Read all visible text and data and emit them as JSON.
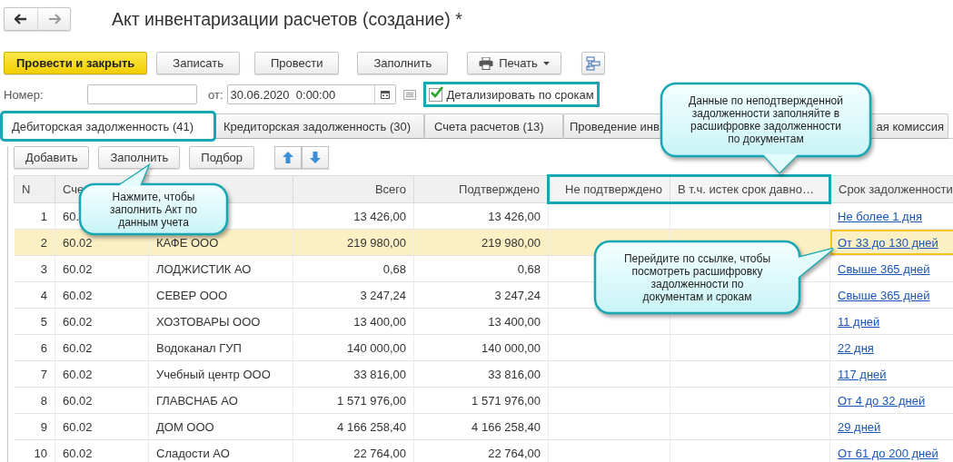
{
  "window": {
    "title": "Акт инвентаризации расчетов (создание) *"
  },
  "toolbar": [
    {
      "kind": "primary",
      "label": "Провести и закрыть"
    },
    {
      "kind": "plain",
      "label": "Записать"
    },
    {
      "kind": "plain",
      "label": "Провести"
    },
    {
      "kind": "plain",
      "label": "Заполнить"
    },
    {
      "kind": "print",
      "label": "Печать"
    },
    {
      "kind": "icon"
    }
  ],
  "header": {
    "number_label": "Номер:",
    "date_label": "от:",
    "date_value": "30.06.2020  0:00:00",
    "detail_checkbox": {
      "label": "Детализировать по срокам",
      "checked": true,
      "highlighted": true
    }
  },
  "tabs": [
    {
      "label": "Дебиторская задолженность (41)",
      "selected": true,
      "highlighted": true
    },
    {
      "label": "Кредиторская задолженность (30)",
      "selected": false,
      "highlighted": false
    },
    {
      "label": "Счета расчетов (13)",
      "selected": false,
      "highlighted": false
    },
    {
      "label": "Проведение инв",
      "selected": false,
      "highlighted": false
    },
    {
      "label": "ая комиссия",
      "selected": false,
      "highlighted": false
    }
  ],
  "table_toolbar": [
    {
      "kind": "text",
      "label": "Добавить"
    },
    {
      "kind": "text",
      "label": "Заполнить"
    },
    {
      "kind": "text",
      "label": "Подбор"
    },
    {
      "kind": "up"
    },
    {
      "kind": "down"
    }
  ],
  "table": {
    "columns": [
      {
        "label": "N",
        "highlighted": false
      },
      {
        "label": "Сче",
        "highlighted": false
      },
      {
        "highlighted": false
      },
      {
        "label": "Всего",
        "highlighted": false
      },
      {
        "label": "Подтверждено",
        "highlighted": false
      },
      {
        "label": "Не подтверждено",
        "highlighted": true
      },
      {
        "label": "В т.ч. истек срок давно…",
        "highlighted": true
      },
      {
        "label": "Срок задолженности",
        "highlighted": false
      }
    ],
    "rows": [
      {
        "n": "1",
        "account": "60.",
        "total": "13 426,00",
        "confirmed": "13 426,00",
        "term": "Не более 1 дня",
        "selected": false
      },
      {
        "n": "2",
        "account": "60.02",
        "debtor": "КАФЕ ООО",
        "total": "219 980,00",
        "confirmed": "219 980,00",
        "term": "От 33 до 130 дней",
        "selected": true
      },
      {
        "n": "3",
        "account": "60.02",
        "debtor": "ЛОДЖИСТИК АО",
        "total": "0,68",
        "confirmed": "0,68",
        "term": "Свыше 365 дней",
        "selected": false
      },
      {
        "n": "4",
        "account": "60.02",
        "debtor": "СЕВЕР ООО",
        "total": "3 247,24",
        "confirmed": "3 247,24",
        "term": "Свыше 365 дней",
        "selected": false
      },
      {
        "n": "5",
        "account": "60.02",
        "debtor": "ХОЗТОВАРЫ ООО",
        "total": "13 400,00",
        "confirmed": "13 400,00",
        "term": "11 дней",
        "selected": false
      },
      {
        "n": "6",
        "account": "60.02",
        "debtor": "Водоканал ГУП",
        "total": "140 000,00",
        "confirmed": "140 000,00",
        "term": "22 дня",
        "selected": false
      },
      {
        "n": "7",
        "account": "60.02",
        "debtor": "Учебный центр ООО",
        "total": "33 816,00",
        "confirmed": "33 816,00",
        "term": "117 дней",
        "selected": false
      },
      {
        "n": "8",
        "account": "60.02",
        "debtor": "ГЛАВСНАБ АО",
        "total": "1 571 976,00",
        "confirmed": "1 571 976,00",
        "term": "От 4 до 32 дней",
        "selected": false
      },
      {
        "n": "9",
        "account": "60.02",
        "debtor": "ДОМ ООО",
        "total": "4 166 258,40",
        "confirmed": "4 166 258,40",
        "term": "29 дней",
        "selected": false
      },
      {
        "n": "10",
        "account": "60.02",
        "debtor": "Сладости АО",
        "total": "22 764,00",
        "confirmed": "22 764,00",
        "term": "От 61 до 200 дней",
        "selected": false
      }
    ]
  },
  "callouts": [
    {
      "text": "Нажмите, чтобы заполнить Акт по данным учета"
    },
    {
      "text": "Данные по неподтвержденной задолженности заполняйте в расшифровке задолженности по документам"
    },
    {
      "text": "Перейдите по ссылке, чтобы посмотреть расшифровку задолженности по документам и срокам"
    }
  ]
}
